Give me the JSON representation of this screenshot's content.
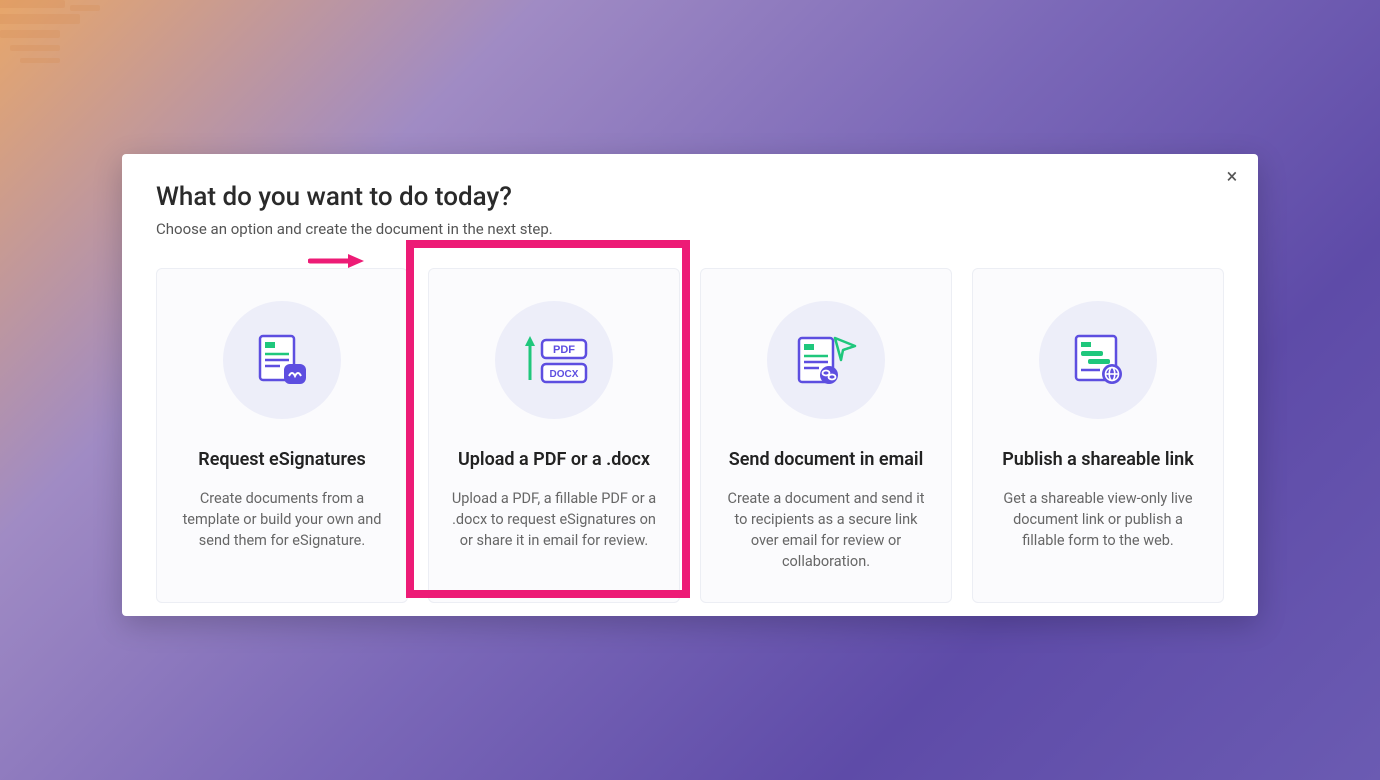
{
  "modal": {
    "title": "What do you want to do today?",
    "subtitle": "Choose an option and create the document in the next step.",
    "close_label": "×"
  },
  "options": [
    {
      "title": "Request eSignatures",
      "desc": "Create documents from a template or build your own and send them for eSignature."
    },
    {
      "title": "Upload a PDF or a .docx",
      "desc": "Upload a PDF, a fillable PDF or a .docx to request eSignatures on or share it in email for review."
    },
    {
      "title": "Send document in email",
      "desc": "Create a document and send it to recipients as a secure link over email for review or collaboration."
    },
    {
      "title": "Publish a shareable link",
      "desc": "Get a shareable view-only live document link or publish a fillable form to the web."
    }
  ],
  "icon_labels": {
    "pdf": "PDF",
    "docx": "DOCX"
  },
  "colors": {
    "highlight": "#ed1b76",
    "primary": "#5d4ee0",
    "accent_green": "#1fc77c"
  }
}
